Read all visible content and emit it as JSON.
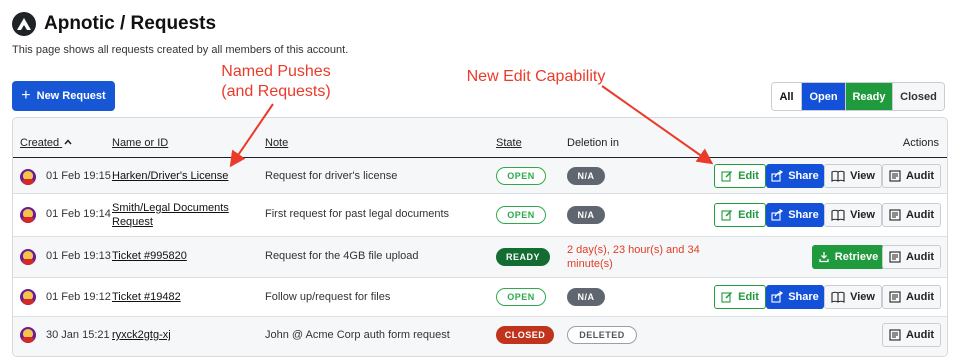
{
  "header": {
    "title": "Apnotic / Requests",
    "subtitle": "This page shows all requests created by all members of this account."
  },
  "toolbar": {
    "new_request_label": "New Request",
    "filters": [
      "All",
      "Open",
      "Ready",
      "Closed"
    ]
  },
  "annotations": {
    "named_pushes": [
      "Named Pushes",
      "(and Requests)"
    ],
    "edit_capability": "New Edit Capability"
  },
  "table": {
    "columns": {
      "created": "Created",
      "name": "Name or ID",
      "note": "Note",
      "state": "State",
      "deletion": "Deletion in",
      "actions": "Actions"
    },
    "rows": [
      {
        "date": "01 Feb 19:15",
        "name": [
          "Harken/Driver's License"
        ],
        "note": "Request for driver's license",
        "state": "OPEN",
        "deletion": "N/A"
      },
      {
        "date": "01 Feb 19:14",
        "name": [
          "Smith/Legal Documents",
          "Request"
        ],
        "note": "First request for past legal documents",
        "state": "OPEN",
        "deletion": "N/A"
      },
      {
        "date": "01 Feb 19:13",
        "name": [
          "Ticket #995820"
        ],
        "note": "Request for the 4GB file upload",
        "state": "READY",
        "deletion": [
          "2 day(s), 23 hour(s) and 34",
          "minute(s)"
        ]
      },
      {
        "date": "01 Feb 19:12",
        "name": [
          "Ticket #19482"
        ],
        "note": "Follow up/request for files",
        "state": "OPEN",
        "deletion": "N/A"
      },
      {
        "date": "30 Jan 15:21",
        "name": [
          "ryxck2gtg-xj"
        ],
        "note": "John @ Acme Corp auth form request",
        "state": "CLOSED",
        "deletion": "DELETED"
      }
    ]
  },
  "actions": {
    "edit": "Edit",
    "share": "Share",
    "view": "View",
    "audit": "Audit",
    "retrieve": "Retrieve"
  },
  "colors": {
    "primary_blue": "#1757d6",
    "ready_green": "#1f9a3c",
    "closed_red": "#c0341e",
    "annotation_red": "#ea3b2a"
  }
}
